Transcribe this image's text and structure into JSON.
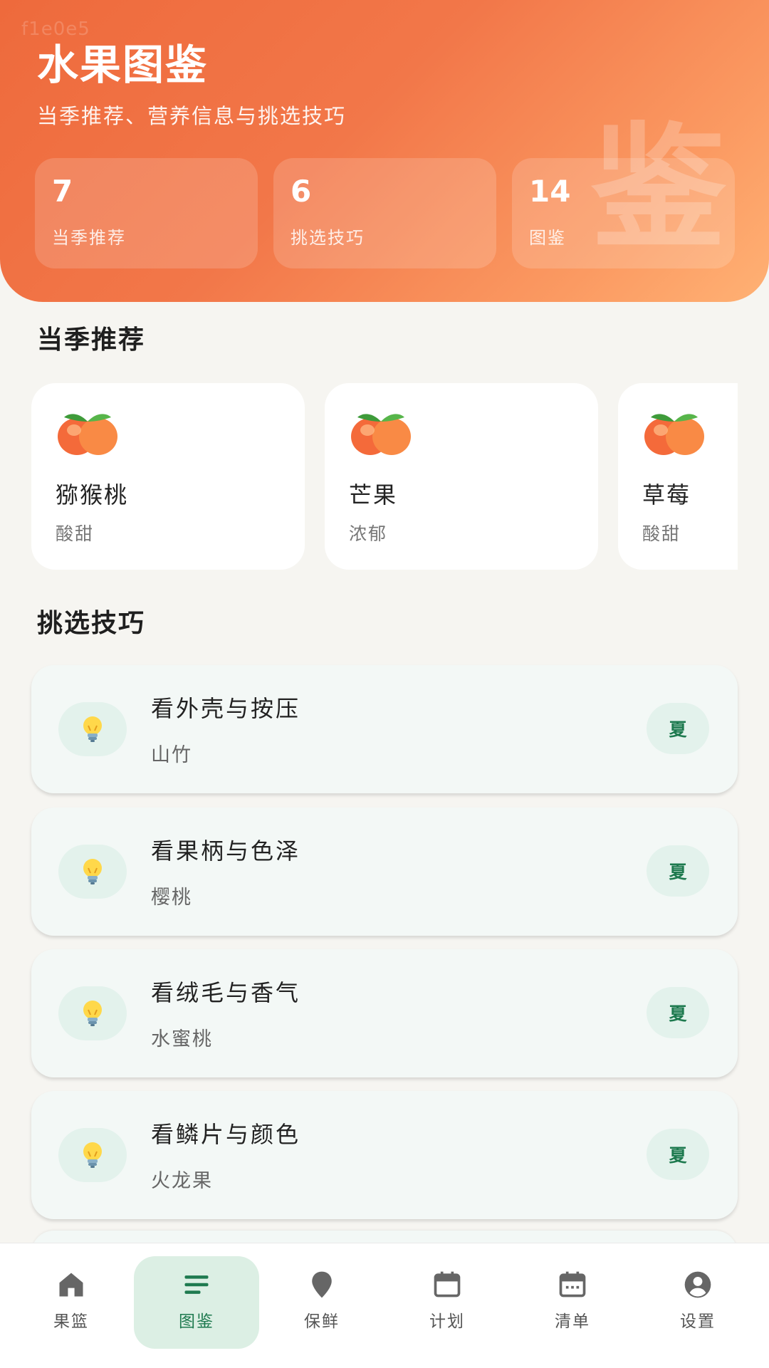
{
  "header": {
    "watermark": "f1e0e5",
    "title": "水果图鉴",
    "subtitle": "当季推荐、营养信息与挑选技巧",
    "big_mark": "鉴",
    "stats": [
      {
        "value": "7",
        "label": "当季推荐"
      },
      {
        "value": "6",
        "label": "挑选技巧"
      },
      {
        "value": "14",
        "label": "图鉴"
      }
    ]
  },
  "season": {
    "title": "当季推荐",
    "items": [
      {
        "name": "猕猴桃",
        "taste": "酸甜",
        "icon": "peach-icon"
      },
      {
        "name": "芒果",
        "taste": "浓郁",
        "icon": "peach-icon"
      },
      {
        "name": "草莓",
        "taste": "酸甜",
        "icon": "peach-icon"
      }
    ]
  },
  "tips": {
    "title": "挑选技巧",
    "items": [
      {
        "title": "看外壳与按压",
        "fruit": "山竹",
        "season": "夏",
        "icon": "lightbulb-icon"
      },
      {
        "title": "看果柄与色泽",
        "fruit": "樱桃",
        "season": "夏",
        "icon": "lightbulb-icon"
      },
      {
        "title": "看绒毛与香气",
        "fruit": "水蜜桃",
        "season": "夏",
        "icon": "lightbulb-icon"
      },
      {
        "title": "看鳞片与颜色",
        "fruit": "火龙果",
        "season": "夏",
        "icon": "lightbulb-icon"
      }
    ]
  },
  "nav": {
    "items": [
      {
        "label": "果篮",
        "icon": "home-icon"
      },
      {
        "label": "图鉴",
        "icon": "list-icon",
        "active": true
      },
      {
        "label": "保鲜",
        "icon": "location-pin-icon"
      },
      {
        "label": "计划",
        "icon": "calendar-icon"
      },
      {
        "label": "清单",
        "icon": "calendar-dots-icon"
      },
      {
        "label": "设置",
        "icon": "account-circle-icon"
      }
    ]
  },
  "colors": {
    "accent": "#1e7a4f",
    "header_start": "#ee6a3c",
    "header_end": "#ffb174",
    "background": "#f6f5f1"
  }
}
